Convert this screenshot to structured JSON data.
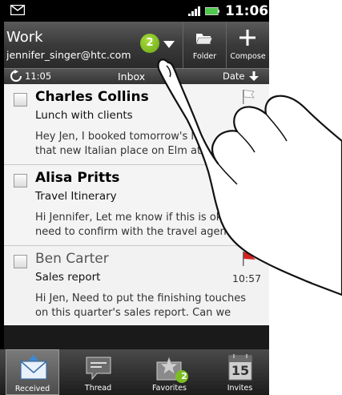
{
  "status": {
    "time": "11:06"
  },
  "header": {
    "account": "Work",
    "email": "jennifer_singer@htc.com",
    "unread_count": "2",
    "folder_label": "Folder",
    "compose_label": "Compose"
  },
  "inbox_bar": {
    "sync_time": "11:05",
    "title": "Inbox",
    "sort": "Date"
  },
  "messages": [
    {
      "sender": "Charles Collins",
      "subject": "Lunch with clients",
      "preview_line1": "Hey Jen, I booked tomorrow's lu",
      "preview_line2": "that new Italian place on Elm at",
      "time": ""
    },
    {
      "sender": "Alisa Pritts",
      "subject": "Travel Itinerary",
      "preview_line1": "Hi Jennifer, Let me know if this is ok",
      "preview_line2": "need to confirm with the travel agent",
      "time": ""
    },
    {
      "sender": "Ben Carter",
      "subject": "Sales report",
      "preview_line1": "Hi Jen, Need to put the finishing touches",
      "preview_line2": "on this quarter's sales report. Can we",
      "time": "10:57"
    }
  ],
  "tabs": [
    {
      "label": "Received"
    },
    {
      "label": "Thread"
    },
    {
      "label": "Favorites",
      "badge": "2"
    },
    {
      "label": "Invites",
      "calendar_day": "15"
    }
  ],
  "icons": {
    "status": [
      "mail-icon",
      "signal-icon",
      "battery-icon"
    ],
    "header": [
      "folder-icon",
      "plus-icon",
      "chevron-down-icon"
    ],
    "inbox_bar": [
      "refresh-icon",
      "sort-arrow-icon"
    ],
    "tabs": [
      "envelope-icon",
      "speech-bubble-icon",
      "star-envelope-icon",
      "calendar-icon"
    ]
  },
  "colors": {
    "badge_green": "#7bbd22",
    "flag_red": "#d62020",
    "battery_green": "#4ec94e"
  }
}
